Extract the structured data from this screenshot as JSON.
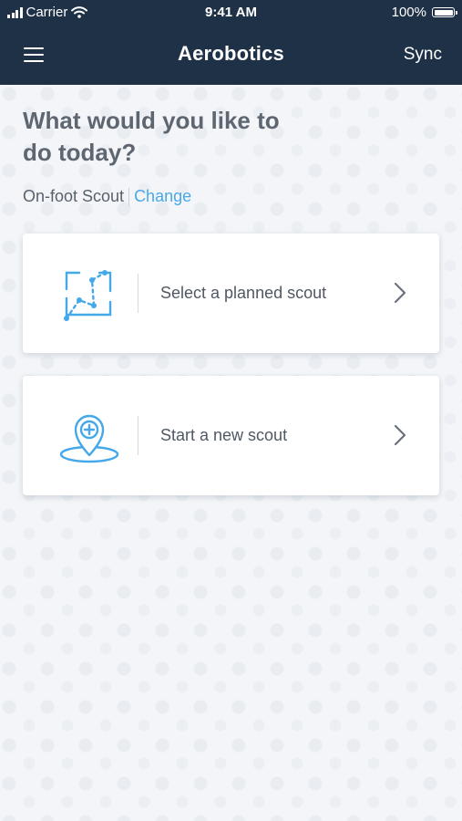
{
  "status_bar": {
    "carrier": "Carrier",
    "time": "9:41 AM",
    "battery_percent": "100%"
  },
  "header": {
    "brand": "Aerobotics",
    "sync_label": "Sync"
  },
  "main": {
    "headline": "What would you like to do today?",
    "mode_label": "On-foot Scout",
    "change_link": "Change"
  },
  "actions": [
    {
      "label": "Select a planned scout",
      "icon": "route-map-icon"
    },
    {
      "label": "Start a new scout",
      "icon": "location-add-icon"
    }
  ],
  "colors": {
    "header_bg": "#1f3147",
    "accent": "#4aa8e8",
    "text": "#5e6671",
    "background": "#f3f5f8"
  }
}
